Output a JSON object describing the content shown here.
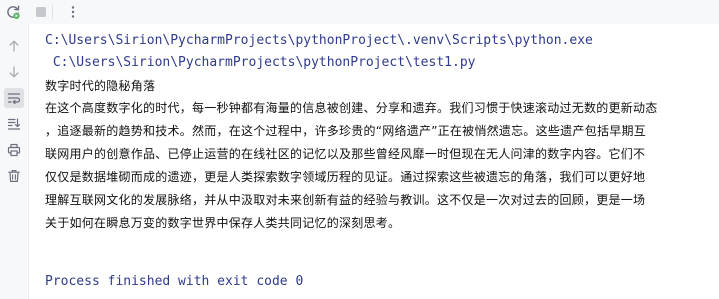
{
  "toolbar": {
    "buttons": [
      {
        "name": "rerun",
        "icon": "rerun-icon"
      },
      {
        "name": "stop",
        "icon": "stop-icon"
      },
      {
        "name": "more",
        "icon": "more-vertical-icon"
      }
    ]
  },
  "gutter": {
    "buttons": [
      {
        "name": "scroll-up",
        "icon": "arrow-up-icon"
      },
      {
        "name": "scroll-down",
        "icon": "arrow-down-icon"
      },
      {
        "name": "soft-wrap",
        "icon": "soft-wrap-icon",
        "active": true
      },
      {
        "name": "scroll-to-end",
        "icon": "scroll-to-end-icon"
      },
      {
        "name": "print",
        "icon": "print-icon"
      },
      {
        "name": "clear",
        "icon": "trash-icon"
      }
    ]
  },
  "console": {
    "command_line": "C:\\Users\\Sirion\\PycharmProjects\\pythonProject\\.venv\\Scripts\\python.exe",
    "script_line": " C:\\Users\\Sirion\\PycharmProjects\\pythonProject\\test1.py",
    "output_title": "数字时代的隐秘角落",
    "output_lines": [
      "在这个高度数字化的时代，每一秒钟都有海量的信息被创建、分享和遗弃。我们习惯于快速滚动过无数的更新动态",
      "，追逐最新的趋势和技术。然而，在这个过程中，许多珍贵的“网络遗产”正在被悄然遗忘。这些遗产包括早期互",
      "联网用户的创意作品、已停止运营的在线社区的记忆以及那些曾经风靡一时但现在无人问津的数字内容。它们不",
      "仅仅是数据堆砌而成的遗迹，更是人类探索数字领域历程的见证。通过探索这些被遗忘的角落，我们可以更好地",
      "理解互联网文化的发展脉络，并从中汲取对未来创新有益的经验与教训。这不仅是一次对过去的回顾，更是一场",
      "关于如何在瞬息万变的数字世界中保存人类共同记忆的深刻思考。"
    ],
    "exit_message": "Process finished with exit code 0"
  },
  "colors": {
    "path_text": "#2e3b8c",
    "output_text": "#111111",
    "panel_bg": "#f7f8fa",
    "icon_gray": "#6c707e",
    "rerun_green": "#5fb865"
  }
}
